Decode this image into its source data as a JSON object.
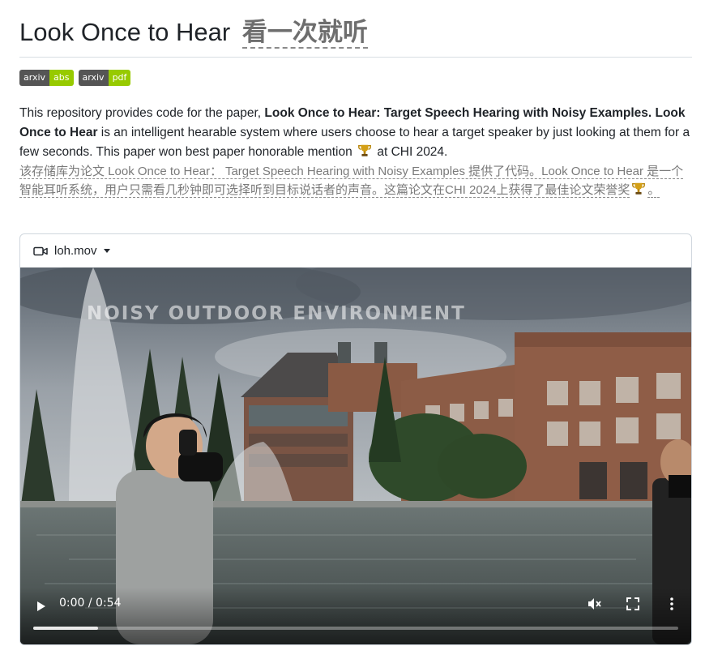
{
  "header": {
    "title_en": "Look Once to Hear",
    "title_zh": "看一次就听"
  },
  "badges": [
    {
      "left": "arxiv",
      "right": "abs",
      "color": "#97ca00"
    },
    {
      "left": "arxiv",
      "right": "pdf",
      "color": "#97ca00"
    }
  ],
  "intro": {
    "p1": "This repository provides code for the paper, ",
    "paper_title": "Look Once to Hear: Target Speech Hearing with Noisy Examples.",
    "p2": " ",
    "system_name": "Look Once to Hear",
    "p3": " is an intelligent hearable system where users choose to hear a target speaker by just looking at them for a few seconds. This paper won best paper honorable mention ",
    "p4": " at CHI 2024.",
    "trophy_icon": "trophy-icon"
  },
  "intro_zh": {
    "text": "该存储库为论文 Look Once to Hear： Target Speech Hearing with Noisy Examples 提供了代码。Look Once to Hear 是一个智能耳听系统，用户只需看几秒钟即可选择听到目标说话者的声音。这篇论文在CHI 2024上获得了最佳论文荣誉奖",
    "end": "。"
  },
  "video": {
    "filename": "loh.mov",
    "overlay": "NOISY OUTDOOR ENVIRONMENT",
    "time": "0:00 / 0:54",
    "progress": 0.1,
    "icons": [
      "video-camera-icon",
      "play-icon",
      "mute-icon",
      "fullscreen-icon",
      "more-vert-icon"
    ]
  }
}
